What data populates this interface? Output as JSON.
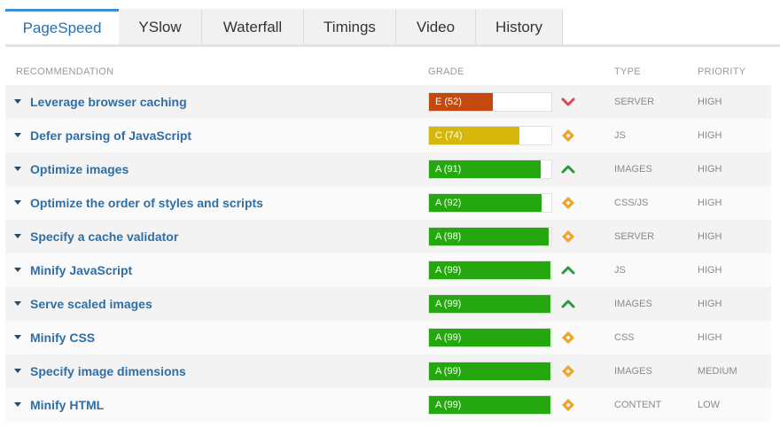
{
  "tabs": [
    {
      "label": "PageSpeed",
      "active": true
    },
    {
      "label": "YSlow"
    },
    {
      "label": "Waterfall"
    },
    {
      "label": "Timings"
    },
    {
      "label": "Video"
    },
    {
      "label": "History"
    }
  ],
  "columns": {
    "recommendation": "RECOMMENDATION",
    "grade": "GRADE",
    "type": "TYPE",
    "priority": "PRIORITY"
  },
  "colors": {
    "grade_e": "#c5490f",
    "grade_c": "#d6b80d",
    "grade_a": "#25a80f",
    "trend_up": "#2a9a3f",
    "trend_down": "#e0434f",
    "trend_neutral": "#f0a32a"
  },
  "rows": [
    {
      "recommendation": "Leverage browser caching",
      "grade_text": "E (52)",
      "score": 52,
      "grade": "E",
      "trend_icon": "chevron-down-icon",
      "type": "SERVER",
      "priority": "HIGH"
    },
    {
      "recommendation": "Defer parsing of JavaScript",
      "grade_text": "C (74)",
      "score": 74,
      "grade": "C",
      "trend_icon": "diamond-icon",
      "type": "JS",
      "priority": "HIGH"
    },
    {
      "recommendation": "Optimize images",
      "grade_text": "A (91)",
      "score": 91,
      "grade": "A",
      "trend_icon": "chevron-up-icon",
      "type": "IMAGES",
      "priority": "HIGH"
    },
    {
      "recommendation": "Optimize the order of styles and scripts",
      "grade_text": "A (92)",
      "score": 92,
      "grade": "A",
      "trend_icon": "diamond-icon",
      "type": "CSS/JS",
      "priority": "HIGH"
    },
    {
      "recommendation": "Specify a cache validator",
      "grade_text": "A (98)",
      "score": 98,
      "grade": "A",
      "trend_icon": "diamond-icon",
      "type": "SERVER",
      "priority": "HIGH"
    },
    {
      "recommendation": "Minify JavaScript",
      "grade_text": "A (99)",
      "score": 99,
      "grade": "A",
      "trend_icon": "chevron-up-icon",
      "type": "JS",
      "priority": "HIGH"
    },
    {
      "recommendation": "Serve scaled images",
      "grade_text": "A (99)",
      "score": 99,
      "grade": "A",
      "trend_icon": "chevron-up-icon",
      "type": "IMAGES",
      "priority": "HIGH"
    },
    {
      "recommendation": "Minify CSS",
      "grade_text": "A (99)",
      "score": 99,
      "grade": "A",
      "trend_icon": "diamond-icon",
      "type": "CSS",
      "priority": "HIGH"
    },
    {
      "recommendation": "Specify image dimensions",
      "grade_text": "A (99)",
      "score": 99,
      "grade": "A",
      "trend_icon": "diamond-icon",
      "type": "IMAGES",
      "priority": "MEDIUM"
    },
    {
      "recommendation": "Minify HTML",
      "grade_text": "A (99)",
      "score": 99,
      "grade": "A",
      "trend_icon": "diamond-icon",
      "type": "CONTENT",
      "priority": "LOW"
    }
  ]
}
